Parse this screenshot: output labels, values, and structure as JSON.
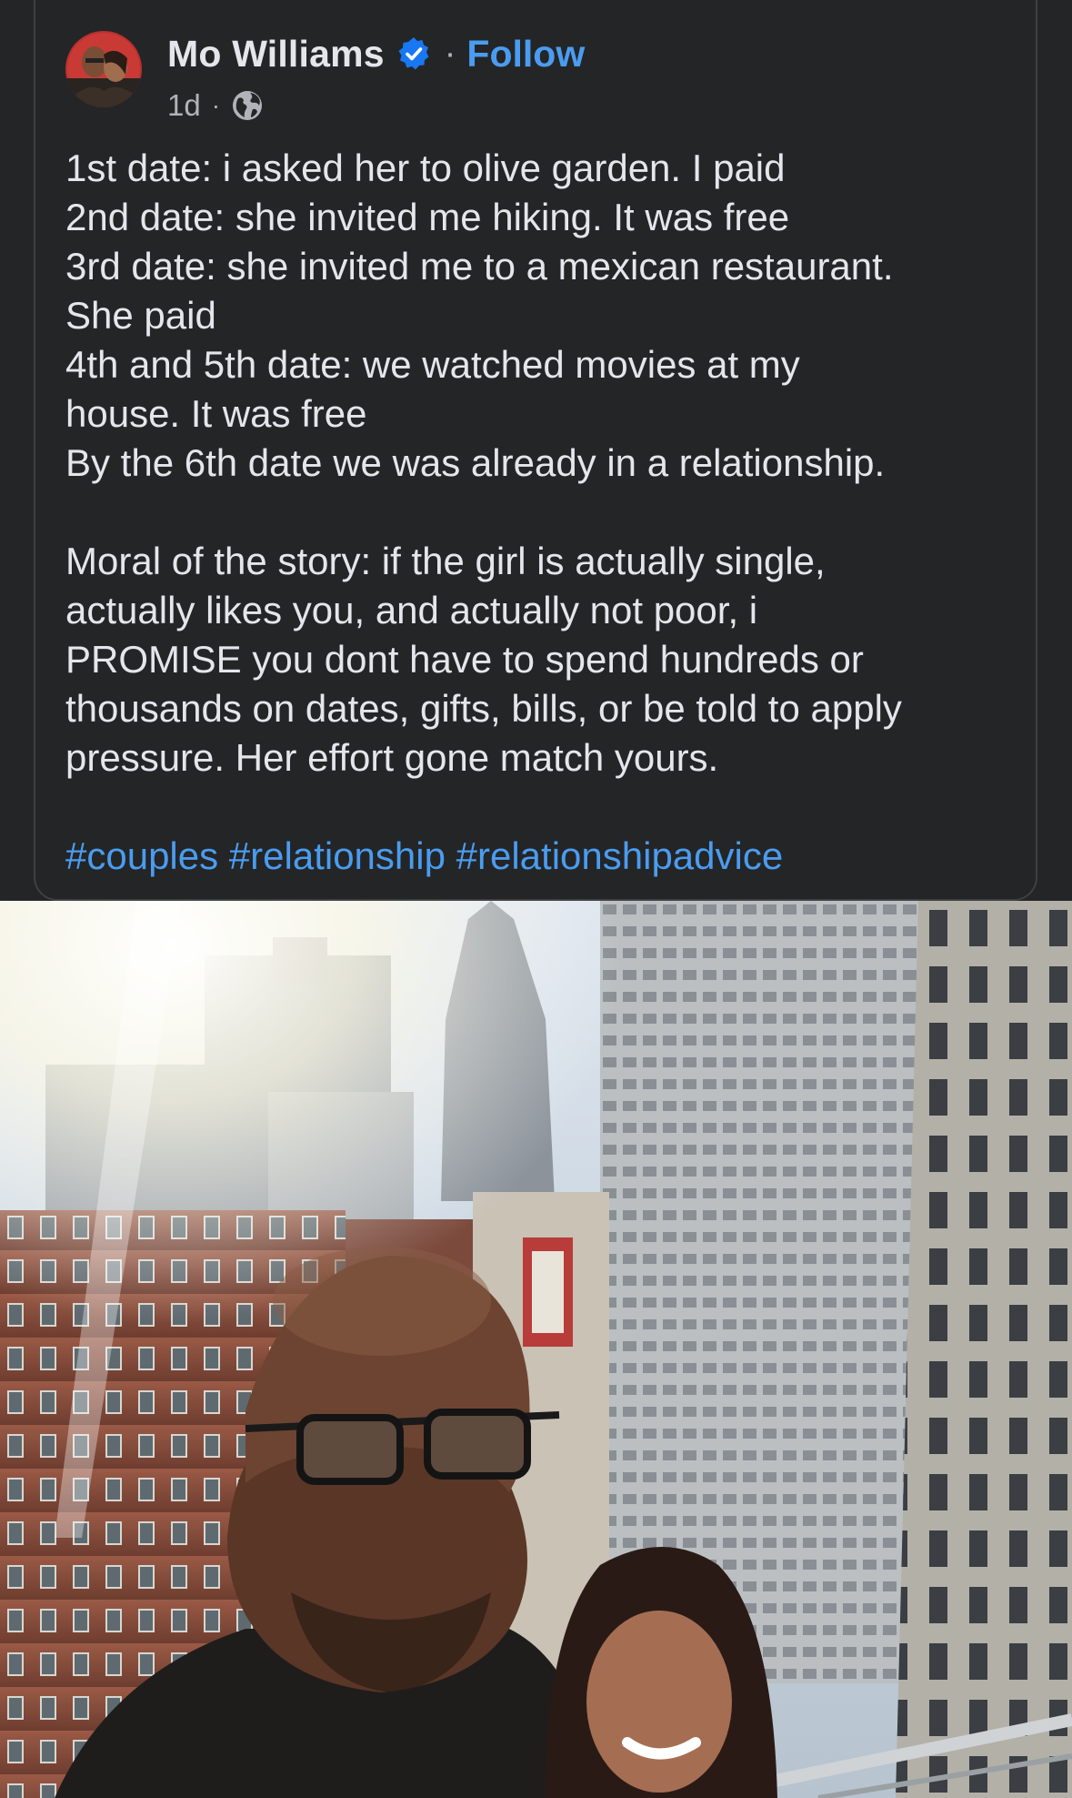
{
  "post": {
    "author": "Mo Williams",
    "follow_label": "Follow",
    "separator": "·",
    "time": "1d",
    "time_separator": "·",
    "body_lines": [
      "1st date: i asked her to olive garden. I paid",
      "2nd date: she invited me hiking. It was free",
      "3rd date: she invited me to a mexican restaurant.",
      "She paid",
      "4th and 5th date: we watched movies at my",
      "house. It was free",
      "By the 6th date we was already in a relationship.",
      "",
      "Moral of the story: if the girl is actually single,",
      "actually likes you, and actually not poor, i",
      "PROMISE you dont have to spend hundreds or",
      "thousands on dates, gifts, bills, or be told to apply",
      "pressure. Her effort gone match yours."
    ],
    "hashtags": [
      "#couples",
      "#relationship",
      "#relationshipadvice"
    ]
  },
  "icons": {
    "verified": "verified-badge-icon",
    "audience": "globe-icon"
  },
  "colors": {
    "background": "#242526",
    "text_primary": "#e4e6eb",
    "text_secondary": "#b0b3b8",
    "link_blue": "#4a9cf0",
    "verified_blue": "#1877f2"
  }
}
